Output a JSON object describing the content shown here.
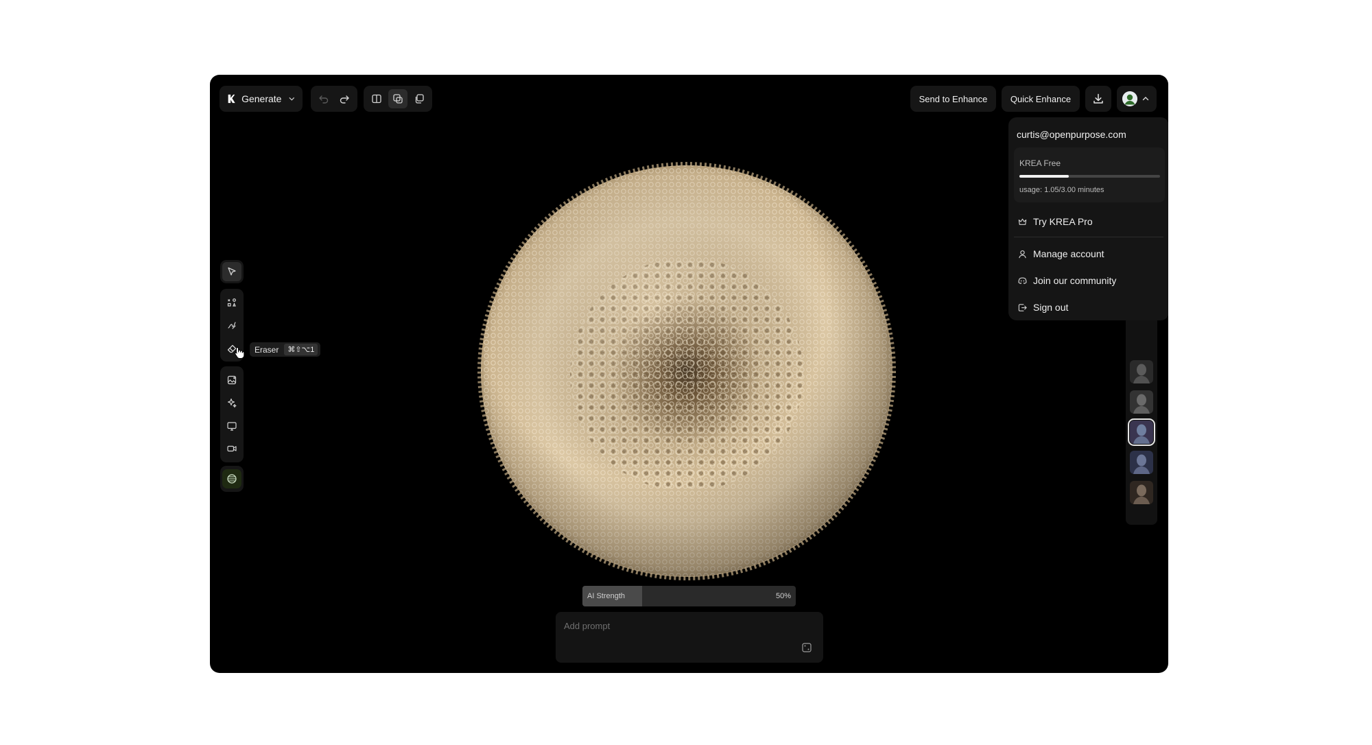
{
  "toolbar": {
    "mode_label": "Generate",
    "send_to_enhance": "Send to Enhance",
    "quick_enhance": "Quick Enhance"
  },
  "tooltip": {
    "label": "Eraser",
    "shortcut": "⌘⇧⌥1"
  },
  "tools": [
    {
      "name": "select",
      "icon": "pointer-icon",
      "active": true
    },
    {
      "name": "objects",
      "icon": "grid-objects-icon"
    },
    {
      "name": "draw",
      "icon": "pen-scribble-icon"
    },
    {
      "name": "eraser",
      "icon": "eraser-icon"
    },
    {
      "name": "image",
      "icon": "image-add-icon"
    },
    {
      "name": "enhance",
      "icon": "sparkle-icon"
    },
    {
      "name": "screen",
      "icon": "monitor-icon"
    },
    {
      "name": "video",
      "icon": "video-camera-icon"
    },
    {
      "name": "world",
      "icon": "globe-icon"
    }
  ],
  "strength": {
    "label": "AI Strength",
    "value_label": "50%",
    "value": 0.28
  },
  "prompt": {
    "placeholder": "Add prompt"
  },
  "account_menu": {
    "email": "curtis@openpurpose.com",
    "plan": "KREA Free",
    "usage": "usage: 1.05/3.00 minutes",
    "usage_fraction": 0.35,
    "items": {
      "try_pro": "Try KREA Pro",
      "manage": "Manage account",
      "community": "Join our community",
      "sign_out": "Sign out"
    }
  },
  "thumbnails": [
    {
      "icon": "portrait-thumbnail",
      "selected": false
    },
    {
      "icon": "portrait-thumbnail",
      "selected": false
    },
    {
      "icon": "portrait-thumbnail",
      "selected": true
    },
    {
      "icon": "portrait-thumbnail",
      "selected": false
    },
    {
      "icon": "portrait-thumbnail",
      "selected": false
    }
  ],
  "colors": {
    "canvas_bg": "#000000",
    "panel_bg": "#161616",
    "accent_globe": "#1f2a12"
  }
}
